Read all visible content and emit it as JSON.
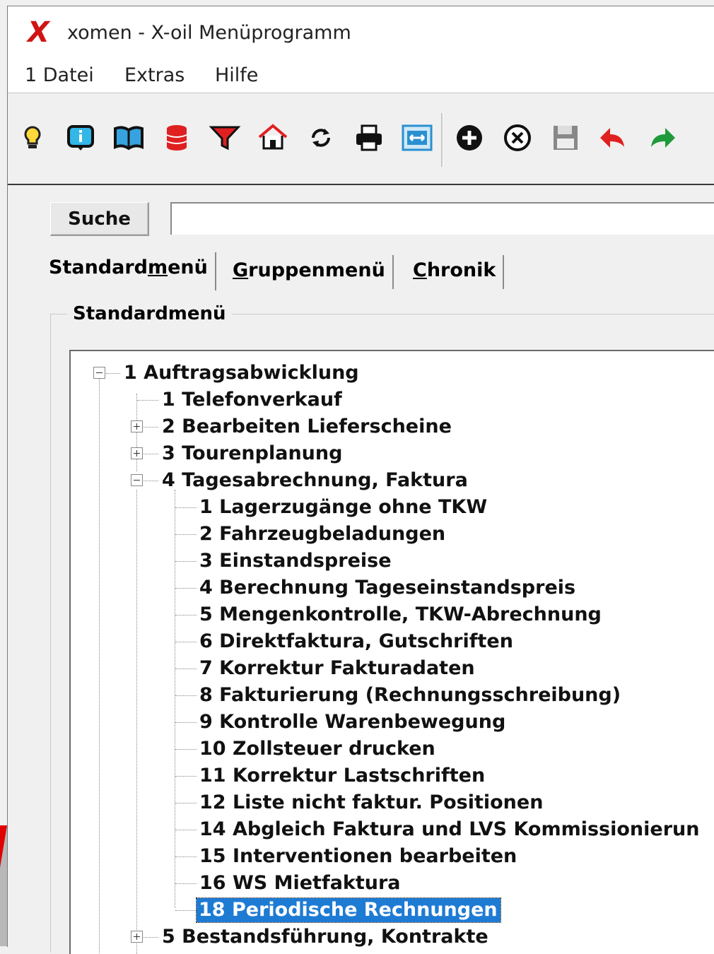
{
  "window": {
    "title": "xomen - X-oil Menüprogramm",
    "logo_glyph": "X",
    "logo_color": "#d01414"
  },
  "menubar": {
    "items": [
      "1 Datei",
      "Extras",
      "Hilfe"
    ]
  },
  "toolbar": {
    "buttons": [
      "lightbulb-icon",
      "info-icon",
      "book-icon",
      "database-icon",
      "filter-icon",
      "home-icon",
      "refresh-icon",
      "printer-icon",
      "resize-icon",
      "add-icon",
      "delete-icon",
      "save-icon",
      "undo-icon",
      "redo-icon"
    ]
  },
  "search": {
    "button_label": "Suche",
    "value": "",
    "placeholder": ""
  },
  "tabs": {
    "standard": {
      "pre": "Standard",
      "accel": "m",
      "post": "enü"
    },
    "gruppen": {
      "accel": "G",
      "post": "ruppenmenü"
    },
    "chronik": {
      "accel": "C",
      "post": "hronik"
    }
  },
  "group_title": "Standardmenü",
  "tree": {
    "root": "1 Auftragsabwicklung",
    "level1": [
      "1 Telefonverkauf",
      "2 Bearbeiten Lieferscheine",
      "3 Tourenplanung",
      "4 Tagesabrechnung, Faktura",
      "5 Bestandsführung, Kontrakte"
    ],
    "level2": [
      "1 Lagerzugänge ohne TKW",
      "2 Fahrzeugbeladungen",
      "3 Einstandspreise",
      "4 Berechnung Tageseinstandspreis",
      "5 Mengenkontrolle, TKW-Abrechnung",
      "6 Direktfaktura, Gutschriften",
      "7 Korrektur Fakturadaten",
      "8 Fakturierung (Rechnungsschreibung)",
      "9 Kontrolle Warenbewegung",
      "10 Zollsteuer drucken",
      "11 Korrektur Lastschriften",
      "12 Liste nicht faktur. Positionen",
      "14 Abgleich Faktura und LVS Kommissionierun",
      "15 Interventionen bearbeiten",
      "16 WS Mietfaktura",
      "18 Periodische Rechnungen"
    ],
    "selected": "18 Periodische Rechnungen"
  },
  "colors": {
    "selection": "#1e7bd4",
    "accent_red": "#d01414",
    "redo_green": "#1e9a3a"
  }
}
